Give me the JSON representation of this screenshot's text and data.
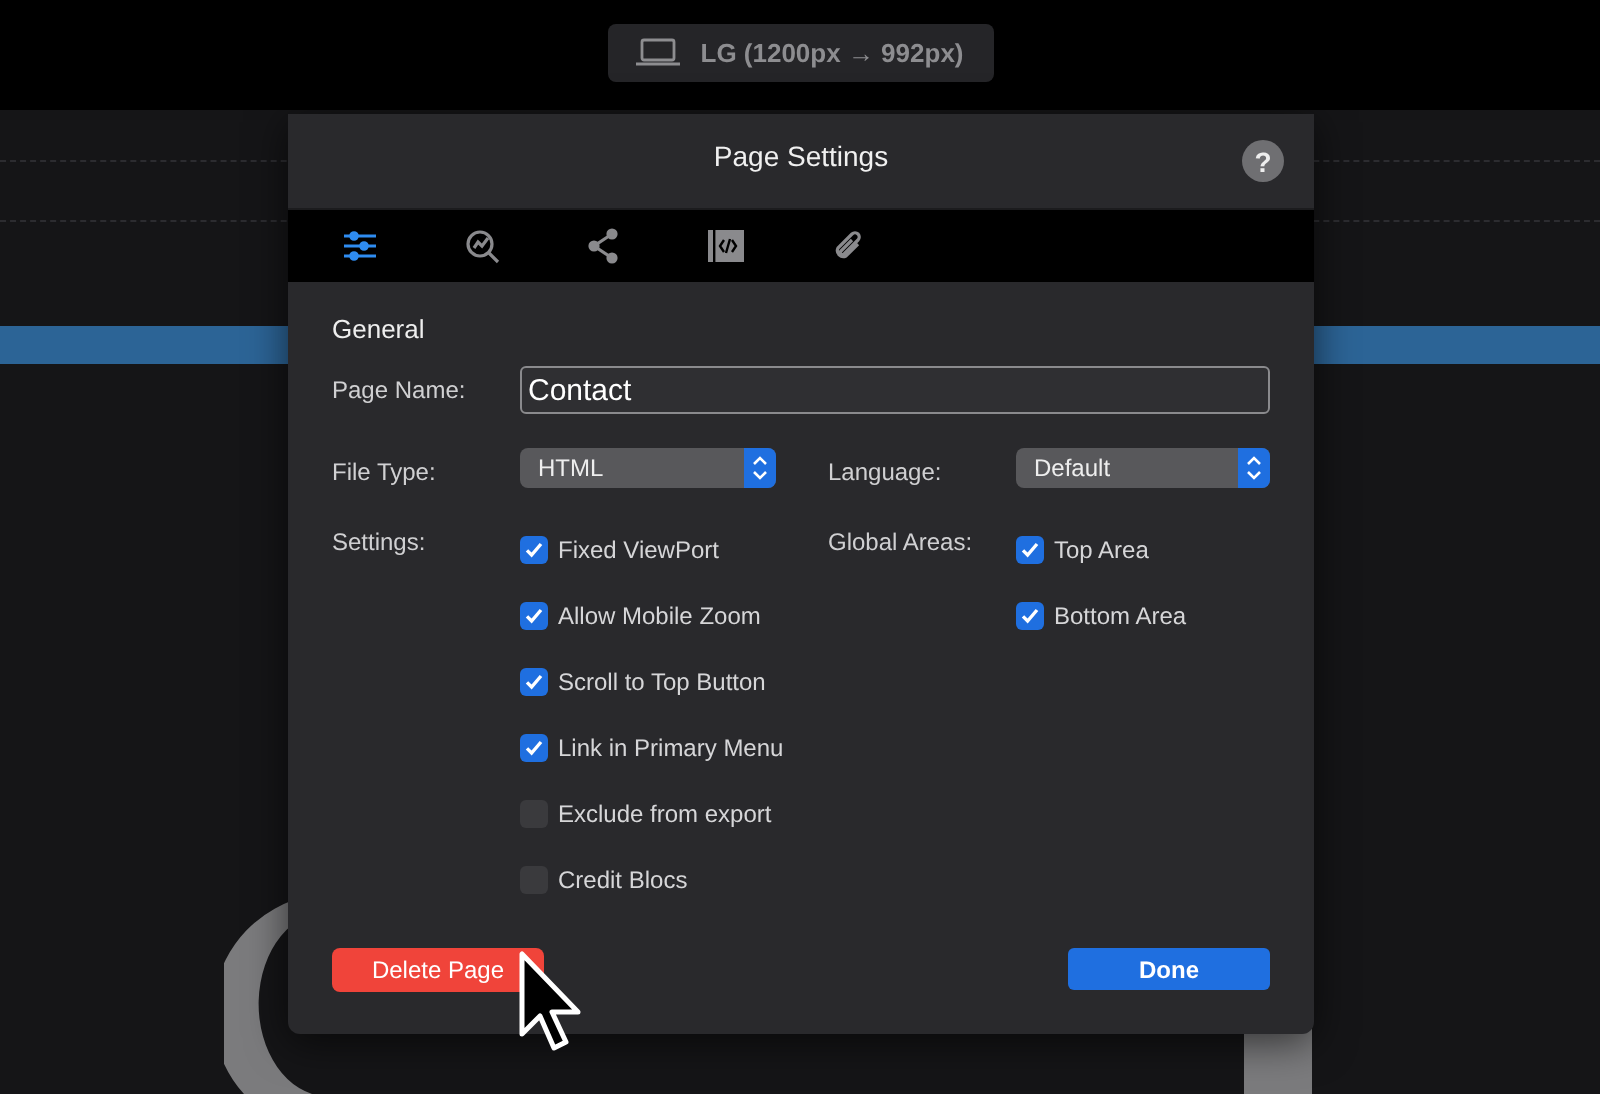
{
  "device_button": {
    "label": "LG (1200px → 992px)"
  },
  "dialog": {
    "title": "Page Settings",
    "help": "?",
    "tabs": [
      {
        "kind": "sliders",
        "selected": true
      },
      {
        "kind": "seo",
        "selected": false
      },
      {
        "kind": "share",
        "selected": false
      },
      {
        "kind": "code",
        "selected": false
      },
      {
        "kind": "attach",
        "selected": false
      }
    ],
    "section": "General",
    "page_name": {
      "label": "Page Name:",
      "value": "Contact"
    },
    "file_type": {
      "label": "File Type:",
      "value": "HTML"
    },
    "language": {
      "label": "Language:",
      "value": "Default"
    },
    "settings": {
      "label": "Settings:",
      "items": [
        {
          "label": "Fixed ViewPort",
          "checked": true
        },
        {
          "label": "Allow Mobile Zoom",
          "checked": true
        },
        {
          "label": "Scroll to Top Button",
          "checked": true
        },
        {
          "label": "Link in Primary Menu",
          "checked": true
        },
        {
          "label": "Exclude from export",
          "checked": false
        },
        {
          "label": "Credit Blocs",
          "checked": false
        }
      ]
    },
    "global_areas": {
      "label": "Global Areas:",
      "items": [
        {
          "label": "Top Area",
          "checked": true
        },
        {
          "label": "Bottom Area",
          "checked": true
        }
      ]
    },
    "buttons": {
      "delete": "Delete Page",
      "done": "Done"
    }
  }
}
